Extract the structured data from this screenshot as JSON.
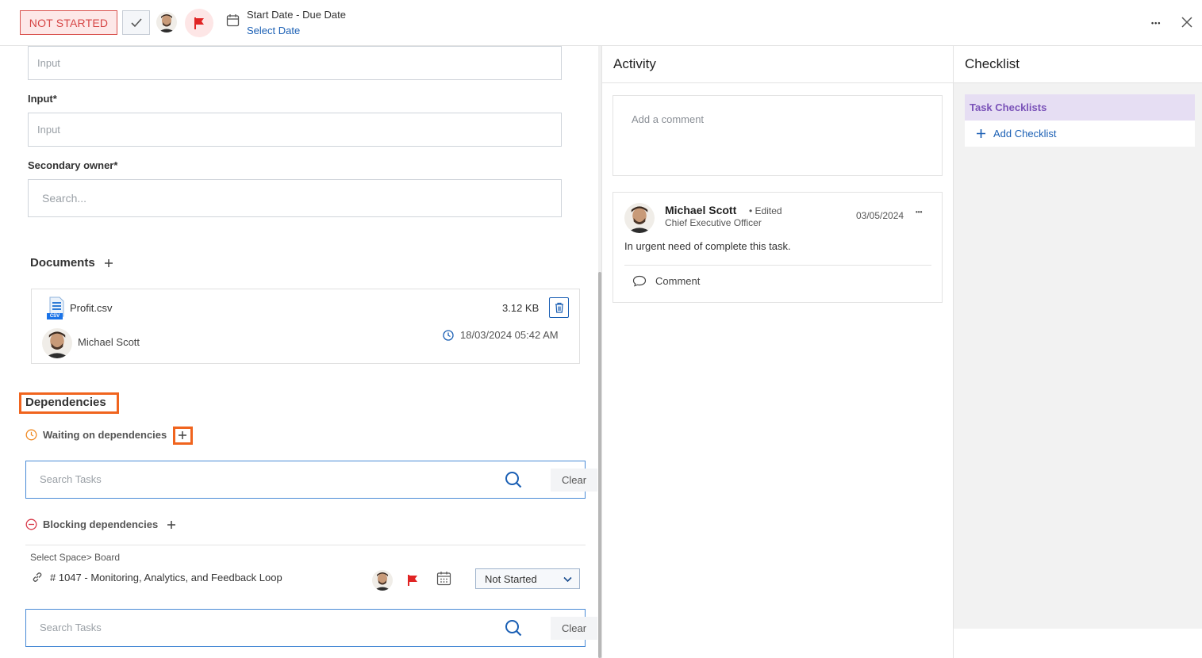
{
  "header": {
    "status_label": "NOT STARTED",
    "date_title": "Start Date - Due Date",
    "date_link": "Select Date",
    "more_label": "•••"
  },
  "form": {
    "field1_placeholder": "Input",
    "field2_label": "Input*",
    "field2_placeholder": "Input",
    "secondary_owner_label": "Secondary owner*",
    "secondary_owner_placeholder": "Search..."
  },
  "documents": {
    "title": "Documents",
    "file_name": "Profit.csv",
    "file_type_badge": "CSV",
    "file_size": "3.12 KB",
    "uploader": "Michael Scott",
    "timestamp": "18/03/2024 05:42 AM"
  },
  "dependencies": {
    "title": "Dependencies",
    "waiting_label": "Waiting on dependencies",
    "search_placeholder": "Search Tasks",
    "clear_label": "Clear",
    "blocking_label": "Blocking dependencies",
    "breadcrumb": "Select Space> Board",
    "task_label": "# 1047 - Monitoring, Analytics, and Feedback Loop",
    "task_status": "Not Started",
    "search_placeholder_2": "Search Tasks",
    "clear_label_2": "Clear"
  },
  "activity": {
    "title": "Activity",
    "comment_placeholder": "Add a comment",
    "author": "Michael Scott",
    "edited": "• Edited",
    "role": "Chief Executive Officer",
    "date": "03/05/2024",
    "more": "•••",
    "body": "In urgent need of complete this task.",
    "comment_action": "Comment"
  },
  "checklist": {
    "title": "Checklist",
    "task_checklists": "Task Checklists",
    "add_checklist": "Add Checklist"
  },
  "colors": {
    "status_red": "#d64545",
    "link_blue": "#1a5fb4",
    "highlight_orange": "#f0641e",
    "checklist_purple": "#7a52b8"
  }
}
